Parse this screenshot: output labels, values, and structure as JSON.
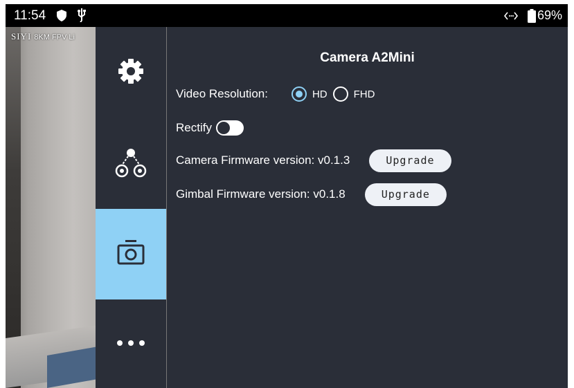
{
  "status_bar": {
    "time": "11:54",
    "battery_percent": "69%",
    "icons": [
      "shield-icon",
      "usb-icon",
      "data-transfer-icon",
      "battery-icon"
    ]
  },
  "camera_feed": {
    "osd_brand": "SIYI",
    "osd_text": "8KM FPV Li"
  },
  "sidebar": {
    "items": [
      {
        "icon": "gear-icon",
        "active": false
      },
      {
        "icon": "gimbal-network-icon",
        "active": false
      },
      {
        "icon": "camera-icon",
        "active": true
      },
      {
        "icon": "more-dots-icon",
        "active": false
      }
    ]
  },
  "panel": {
    "title": "Camera A2Mini",
    "video_resolution": {
      "label": "Video Resolution:",
      "options": [
        {
          "label": "HD",
          "selected": true
        },
        {
          "label": "FHD",
          "selected": false
        }
      ]
    },
    "rectify": {
      "label": "Rectify",
      "enabled": false
    },
    "camera_firmware": {
      "label": "Camera Firmware version: v0.1.3",
      "button": "Upgrade"
    },
    "gimbal_firmware": {
      "label": "Gimbal Firmware version: v0.1.8",
      "button": "Upgrade"
    }
  },
  "colors": {
    "accent": "#8fd1f5",
    "panel_bg": "#2a2e38",
    "button_bg": "#eef1f6"
  }
}
